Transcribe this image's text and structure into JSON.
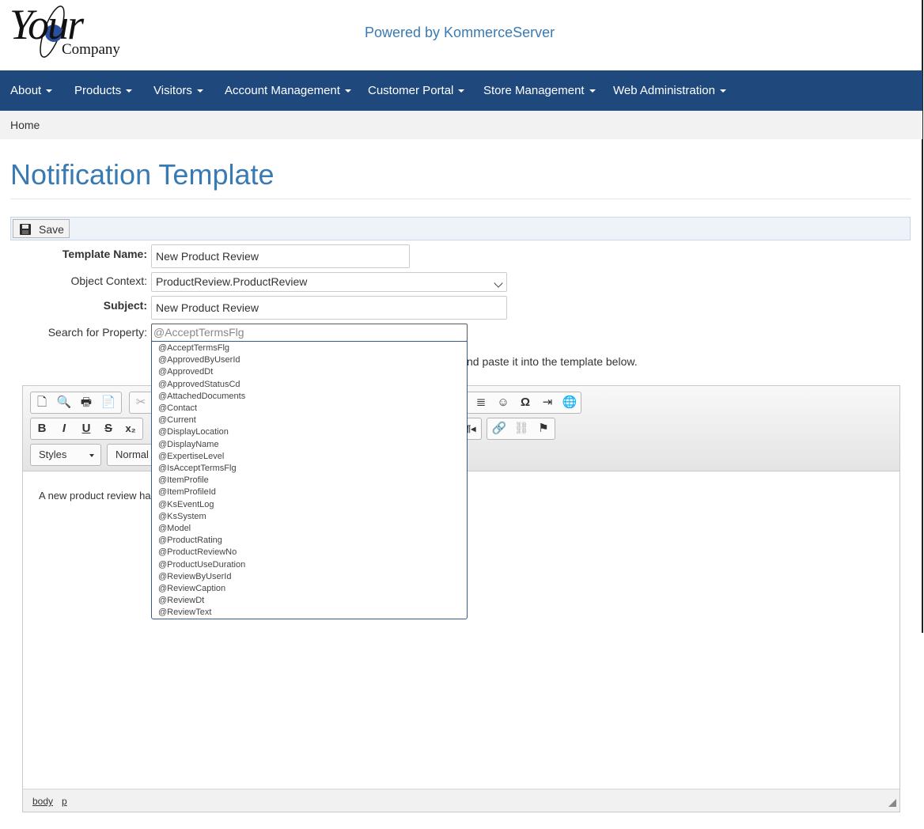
{
  "header": {
    "logo_your": "Your",
    "logo_company": "Company",
    "powered_by": "Powered by KommerceServer"
  },
  "nav": {
    "items": [
      "About",
      "Products",
      "Visitors",
      "Account Management",
      "Customer Portal",
      "Store Management",
      "Web Administration"
    ]
  },
  "breadcrumb": {
    "home": "Home"
  },
  "page": {
    "title": "Notification Template"
  },
  "toolbar": {
    "save_label": "Save"
  },
  "form": {
    "template_name_label": "Template Name:",
    "template_name_value": "New Product Review",
    "object_context_label": "Object Context:",
    "object_context_value": "ProductReview.ProductReview",
    "subject_label": "Subject:",
    "subject_value": "New Product Review",
    "search_label": "Search for Property:",
    "search_value": "@AcceptTermsFlg",
    "instruction_tail": "nd paste it into the template below."
  },
  "editor": {
    "toolbar_icons": [
      "new-page-icon",
      "preview-icon",
      "print-icon",
      "templates-icon",
      "cut-icon",
      "horizontal-line-icon",
      "smiley-icon",
      "special-char-icon",
      "page-break-icon",
      "iframe-icon",
      "bold-icon",
      "italic-icon",
      "underline-icon",
      "strike-icon",
      "subscript-icon",
      "text-direction-icon",
      "link-icon",
      "unlink-icon",
      "anchor-icon"
    ],
    "styles_label": "Styles",
    "format_label": "Normal",
    "body_text": "A new product review has",
    "path": [
      "body",
      "p"
    ]
  },
  "dropdown": {
    "items": [
      "@AcceptTermsFlg",
      "@ApprovedByUserId",
      "@ApprovedDt",
      "@ApprovedStatusCd",
      "@AttachedDocuments",
      "@Contact",
      "@Current",
      "@DisplayLocation",
      "@DisplayName",
      "@ExpertiseLevel",
      "@IsAcceptTermsFlg",
      "@ItemProfile",
      "@ItemProfileId",
      "@KsEventLog",
      "@KsSystem",
      "@Model",
      "@ProductRating",
      "@ProductReviewNo",
      "@ProductUseDuration",
      "@ReviewByUserId",
      "@ReviewCaption",
      "@ReviewDt",
      "@ReviewText"
    ]
  },
  "colors": {
    "nav_bg": "#1f497d",
    "accent": "#3a7ab3"
  }
}
